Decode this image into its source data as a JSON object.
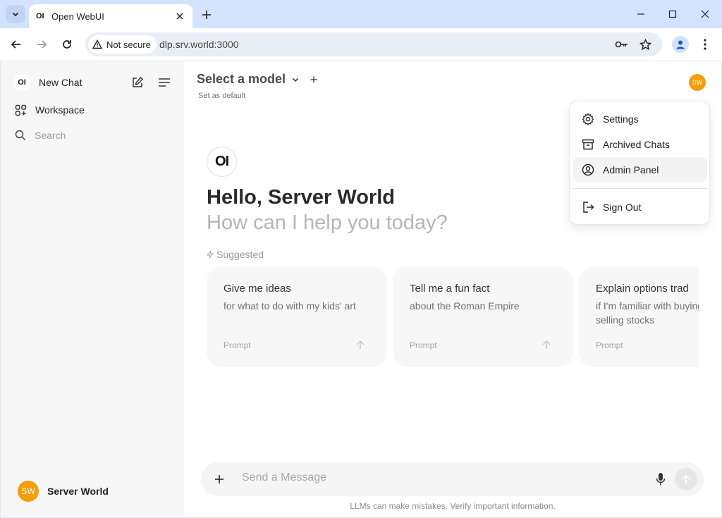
{
  "browser": {
    "tab_favicon": "OI",
    "tab_title": "Open WebUI",
    "security_label": "Not secure",
    "url": "dlp.srv.world:3000"
  },
  "sidebar": {
    "logo": "OI",
    "new_chat": "New Chat",
    "workspace": "Workspace",
    "search_placeholder": "Search",
    "user_initials": "SW",
    "user_name": "Server World"
  },
  "header": {
    "model_label": "Select a model",
    "set_default": "Set as default",
    "avatar_initials": "SW"
  },
  "hero": {
    "logo": "OI",
    "greeting": "Hello, Server World",
    "subtitle": "How can I help you today?",
    "suggested_label": "Suggested"
  },
  "suggestions": [
    {
      "title": "Give me ideas",
      "subtitle": "for what to do with my kids' art",
      "subtitle2": "",
      "prompt_label": "Prompt"
    },
    {
      "title": "Tell me a fun fact",
      "subtitle": "about the Roman Empire",
      "subtitle2": "",
      "prompt_label": "Prompt"
    },
    {
      "title": "Explain options trad",
      "subtitle": "if I'm familiar with buying",
      "subtitle2": "selling stocks",
      "prompt_label": "Prompt"
    }
  ],
  "composer": {
    "placeholder": "Send a Message",
    "disclaimer": "LLMs can make mistakes. Verify important information."
  },
  "user_menu": {
    "items": [
      {
        "label": "Settings",
        "icon": "gear-icon"
      },
      {
        "label": "Archived Chats",
        "icon": "archive-icon"
      },
      {
        "label": "Admin Panel",
        "icon": "user-circle-icon"
      },
      {
        "label": "Sign Out",
        "icon": "sign-out-icon"
      }
    ]
  },
  "colors": {
    "avatar": "#f59e0b",
    "sidebar_bg": "#f7f7f7",
    "tabstrip_bg": "#d3e3fd"
  }
}
